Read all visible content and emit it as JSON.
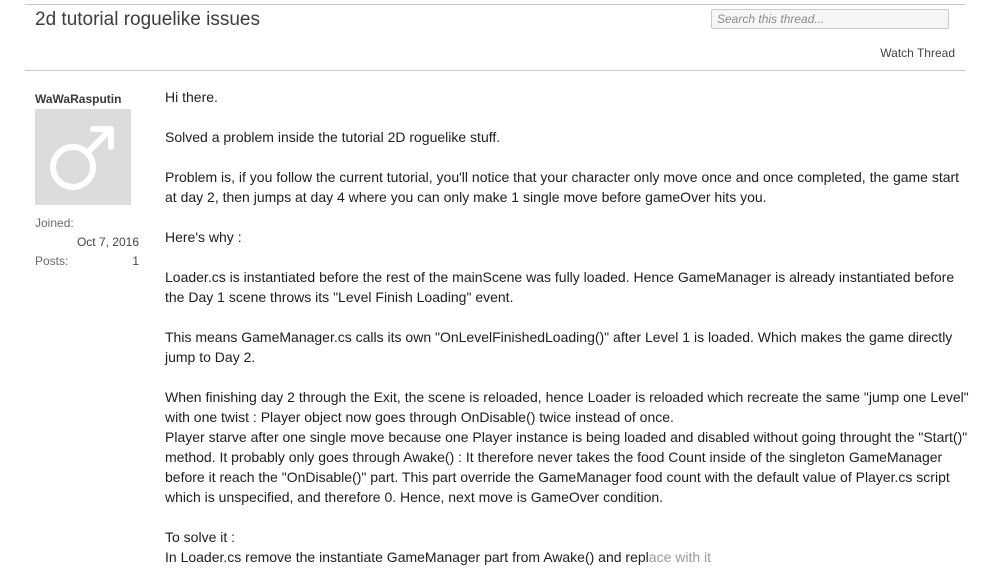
{
  "thread": {
    "title": "2d tutorial roguelike issues",
    "search_placeholder": "Search this thread...",
    "watch_label": "Watch Thread"
  },
  "author": {
    "name": "WaWaRasputin",
    "avatar_icon": "male-symbol-icon",
    "joined_label": "Joined:",
    "joined_value": "Oct 7, 2016",
    "posts_label": "Posts:",
    "posts_value": "1"
  },
  "post": {
    "p1": "Hi there.",
    "p2": "Solved a problem inside the tutorial 2D roguelike stuff.",
    "p3": "Problem is, if you follow the current tutorial, you'll notice that your character only move once and once completed, the game start at day 2, then jumps at day 4 where you can only make 1 single move before gameOver hits you.",
    "p4": "Here's why :",
    "p5": "Loader.cs is instantiated before the rest of the mainScene was fully loaded. Hence GameManager is already instantiated before the Day 1 scene throws its \"Level Finish Loading\" event.",
    "p6": "This means GameManager.cs calls its own \"OnLevelFinishedLoading()\" after Level 1 is loaded. Which makes the game directly jump to Day 2.",
    "p7": "When finishing day 2 through the Exit, the scene is reloaded, hence Loader is reloaded which recreate the same \"jump one Level\" with one twist : Player object now goes through OnDisable() twice instead of once.",
    "p8": "Player starve after one single move because one Player instance is being loaded and disabled without going throught the \"Start()\" method. It probably only goes through Awake() : It therefore never takes the food Count inside of the singleton GameManager before it reach the \"OnDisable()\" part. This part override the GameManager food count with the default value of Player.cs script which is unspecified, and therefore 0. Hence, next move is GameOver condition.",
    "p9": "To solve it :",
    "p10": "In Loader.cs remove the instantiate GameManager part from Awake() and repl",
    "p10_faded": "ace with it"
  },
  "colors": {
    "rule": "#c8c8c8",
    "avatar_bg": "#dcdcdc",
    "text": "#1e1e1e"
  }
}
